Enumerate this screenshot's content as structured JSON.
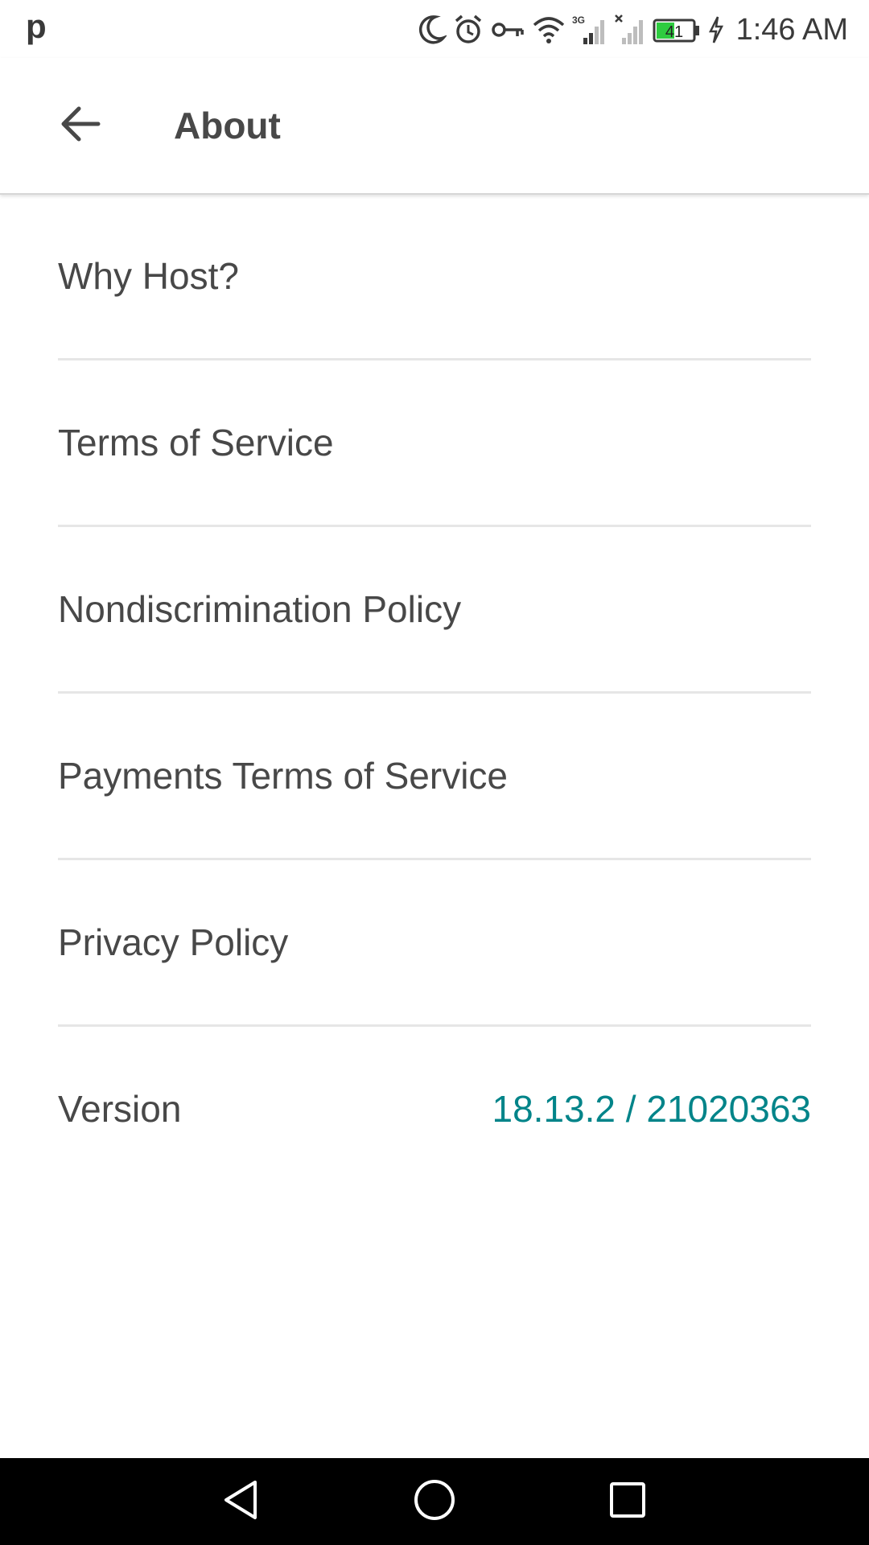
{
  "status_bar": {
    "app_icon_glyph": "p",
    "time": "1:46 AM",
    "network_type": "3G",
    "battery_level": "41",
    "battery_color": "#2ecc40",
    "icons": [
      "moon-icon",
      "alarm-icon",
      "vpn-key-icon",
      "wifi-icon",
      "signal-3g-icon",
      "signal-no-sim-icon",
      "battery-icon",
      "charging-icon"
    ]
  },
  "toolbar": {
    "title": "About",
    "back_icon": "arrow-left-icon"
  },
  "menu": {
    "items": [
      {
        "label": "Why Host?"
      },
      {
        "label": "Terms of Service"
      },
      {
        "label": "Nondiscrimination Policy"
      },
      {
        "label": "Payments Terms of Service"
      },
      {
        "label": "Privacy Policy"
      }
    ],
    "version": {
      "label": "Version",
      "value": "18.13.2 / 21020363",
      "value_color": "#008489"
    }
  },
  "nav_bar": {
    "buttons": [
      "back-triangle-icon",
      "home-circle-icon",
      "recents-square-icon"
    ]
  }
}
